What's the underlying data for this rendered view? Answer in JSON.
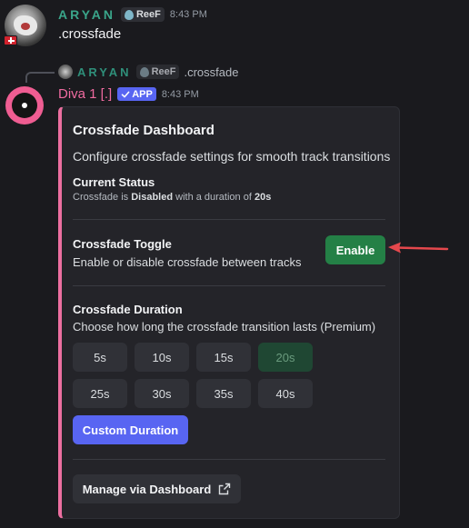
{
  "message1": {
    "username": "ARYAN",
    "tag": "ReeF",
    "timestamp": "8:43 PM",
    "text": ".crossfade"
  },
  "reply": {
    "username": "ARYAN",
    "tag": "ReeF",
    "text": ".crossfade"
  },
  "bot": {
    "name": "Diva 1 [.]",
    "badge": "APP",
    "timestamp": "8:43 PM"
  },
  "embed": {
    "title": "Crossfade Dashboard",
    "description": "Configure crossfade settings for smooth track transitions",
    "status_title": "Current Status",
    "status_prefix": "Crossfade is ",
    "status_state": "Disabled",
    "status_middle": " with a duration of ",
    "status_duration": "20s",
    "toggle_title": "Crossfade Toggle",
    "toggle_desc": "Enable or disable crossfade between tracks",
    "enable_label": "Enable",
    "duration_title": "Crossfade Duration",
    "duration_desc": "Choose how long the crossfade transition lasts (Premium)",
    "durations": [
      "5s",
      "10s",
      "15s",
      "20s",
      "25s",
      "30s",
      "35s",
      "40s"
    ],
    "selected_duration": "20s",
    "custom_label": "Custom Duration",
    "manage_label": "Manage via Dashboard"
  },
  "colors": {
    "accent_bar": "#ec6fa0",
    "enable": "#248046",
    "custom": "#5865f2",
    "arrow": "#e5484d"
  }
}
